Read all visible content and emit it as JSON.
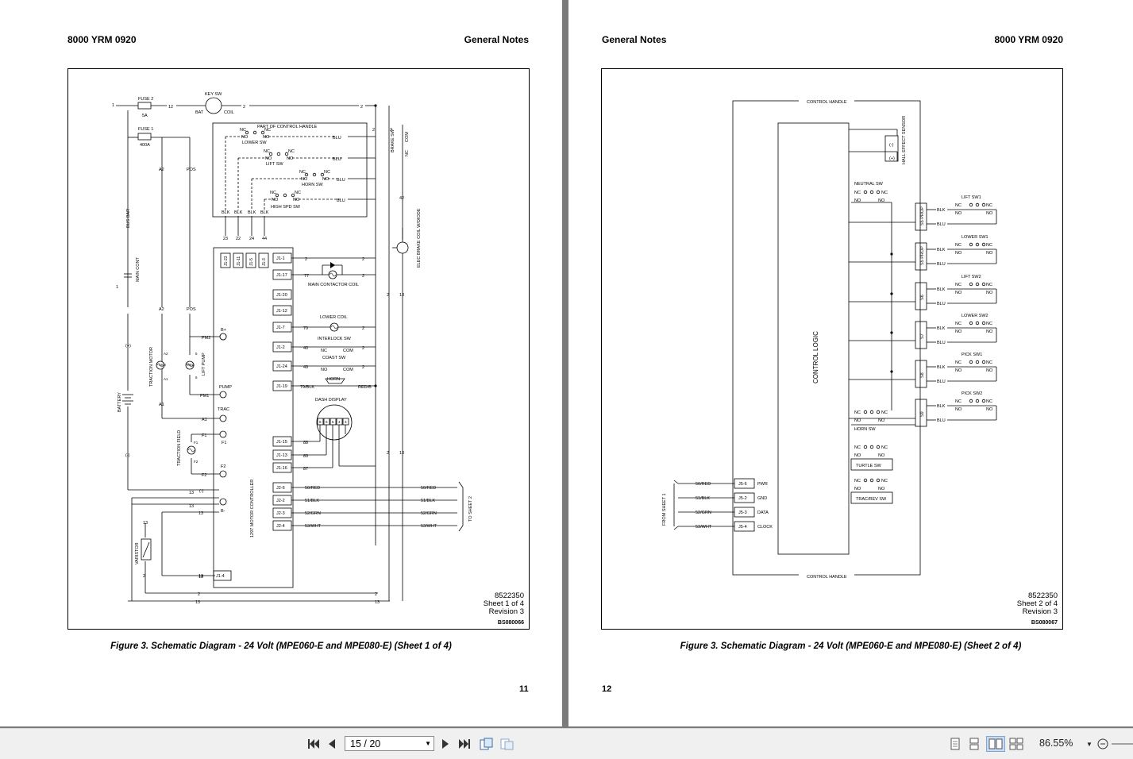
{
  "left_page": {
    "header_left": "8000 YRM 0920",
    "header_right": "General Notes",
    "doc_number": "8522350",
    "sheet": "Sheet 1 of 4",
    "revision": "Revision 3",
    "code": "BS080066",
    "caption": "Figure 3. Schematic Diagram - 24 Volt (MPE060-E and MPE080-E) (Sheet 1 of 4)",
    "page_number": "11",
    "labels": {
      "fuse2": "FUSE 2",
      "fuse2_val": "5A",
      "fuse1": "FUSE 1",
      "fuse1_val": "400A",
      "key_sw": "KEY SW",
      "bat": "BAT",
      "coil": "COIL",
      "part_of_handle": "PART OF CONTROL HANDLE",
      "lower_sw": "LOWER SW",
      "lift_sw": "LIFT SW",
      "horn_sw": "HORN SW",
      "high_spd_sw": "HIGH SPD SW",
      "nc": "NC",
      "no": "NO",
      "blu": "BLU",
      "blk": "BLK",
      "brake_sw": "BRAKE SW",
      "com": "COM",
      "a2": "A2",
      "a1": "A1",
      "pos": "POS",
      "bus_bar": "BUS BAR",
      "main_cont": "MAIN CONT",
      "traction_motor": "TRACTION MOTOR",
      "lift_pump": "LIFT PUMP",
      "arm": "ARM",
      "battery": "BATTERY",
      "plus": "(+)",
      "minus": "(-)",
      "traction_field": "TRACTION FIELD",
      "f1": "F1",
      "f2": "F2",
      "varistor": "VARISTOR",
      "b_plus": "B+",
      "pm2": "PM2",
      "pump": "PUMP",
      "pm1": "PM1",
      "trac": "TRAC",
      "b_minus": "B-",
      "motor_controller": "1297 MOTOR CONTROLLER",
      "main_contactor_coil": "MAIN CONTACTOR COIL",
      "lower_coil": "LOWER COIL",
      "interlock_sw": "INTERLOCK SW",
      "coast_sw": "COAST SW",
      "horn": "HORN",
      "dash_display": "DASH  DISPLAY",
      "elec_brake_coil": "ELEC BRAKE COIL W/DIODE",
      "to_sheet2": "TO SHEET 2",
      "w50red": "50/RED",
      "w51blk": "51/BLK",
      "w52grn": "52/GRN",
      "w53wht": "53/WHT",
      "w79blk": "79/BLK",
      "red_b": "RED/B"
    },
    "connectors": [
      "J1-1",
      "J1-17",
      "J1-20",
      "J1-12",
      "J1-7",
      "J1-2",
      "J1-24",
      "J1-19",
      "J1-15",
      "J1-13",
      "J1-16",
      "J2-6",
      "J2-2",
      "J2-3",
      "J2-4",
      "J1-4"
    ],
    "top_pins": [
      "J1-23",
      "J1-11",
      "J1-5",
      "J1-3"
    ],
    "top_wires": [
      "23",
      "22",
      "24",
      "44"
    ],
    "wire_numbers": [
      "1",
      "12",
      "2",
      "42",
      "77",
      "70",
      "40",
      "49",
      "88",
      "89",
      "87",
      "13"
    ]
  },
  "right_page": {
    "header_left": "General Notes",
    "header_right": "8000 YRM 0920",
    "doc_number": "8522350",
    "sheet": "Sheet 2 of 4",
    "revision": "Revision 3",
    "code": "BS080067",
    "caption": "Figure 3. Schematic Diagram - 24 Volt (MPE060-E and MPE080-E) (Sheet 2 of 4)",
    "page_number": "12",
    "labels": {
      "control_handle": "CONTROL HANDLE",
      "control_logic": "CONTROL LOGIC",
      "hall_effect": "HALL EFFECT SENSOR",
      "minus": "(-)",
      "plus": "(+)",
      "neutral_sw": "NEUTRAL SW",
      "horn_sw": "HORN SW",
      "turtle_sw": "TURTLE SW",
      "trac_rev_sw": "TRAC/REV SW",
      "from_sheet1": "FROM SHEET 1",
      "nc": "NC",
      "no": "NO",
      "blk": "BLK",
      "blu": "BLU"
    },
    "switches": [
      "LIFT SW1",
      "LOWER SW1",
      "LIFT SW2",
      "LOWER SW2",
      "PICK SW1",
      "PICK SW2"
    ],
    "modules": [
      "S5 PROP",
      "S5 PROP",
      "S6",
      "S7",
      "S8",
      "S9"
    ],
    "inputs": [
      {
        "wire": "50/RED",
        "pin": "J5-6",
        "signal": "PWR"
      },
      {
        "wire": "51/BLK",
        "pin": "J5-2",
        "signal": "GND"
      },
      {
        "wire": "52/GRN",
        "pin": "J5-3",
        "signal": "DATA"
      },
      {
        "wire": "53/WHT",
        "pin": "J5-4",
        "signal": "CLOCK"
      }
    ]
  },
  "toolbar": {
    "first_icon": "first-page-icon",
    "prev_icon": "previous-page-icon",
    "page_value": "15 / 20",
    "next_icon": "next-page-icon",
    "last_icon": "last-page-icon",
    "zoom": "86.55%"
  }
}
